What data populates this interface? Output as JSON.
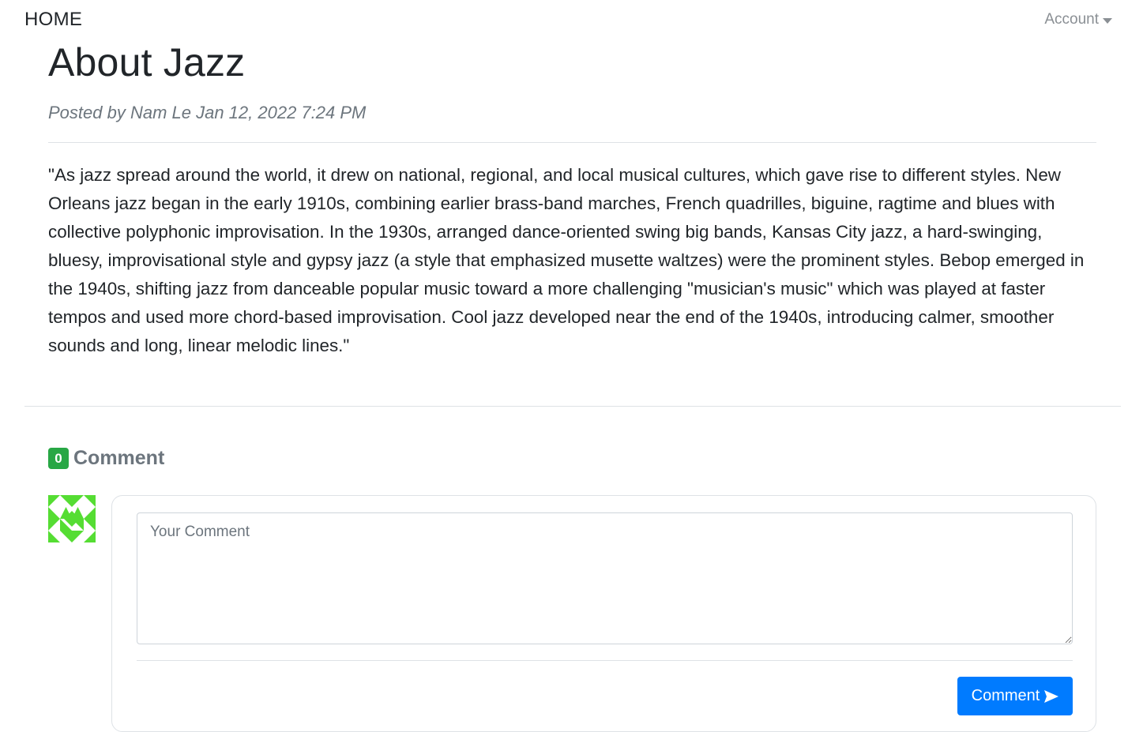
{
  "nav": {
    "home_label": "HOME",
    "account_label": "Account"
  },
  "post": {
    "title": "About Jazz",
    "meta": "Posted by Nam Le Jan 12, 2022 7:24 PM",
    "body": "\"As jazz spread around the world, it drew on national, regional, and local musical cultures, which gave rise to different styles. New Orleans jazz began in the early 1910s, combining earlier brass-band marches, French quadrilles, biguine, ragtime and blues with collective polyphonic improvisation. In the 1930s, arranged dance-oriented swing big bands, Kansas City jazz, a hard-swinging, bluesy, improvisational style and gypsy jazz (a style that emphasized musette waltzes) were the prominent styles. Bebop emerged in the 1940s, shifting jazz from danceable popular music toward a more challenging \"musician's music\" which was played at faster tempos and used more chord-based improvisation. Cool jazz developed near the end of the 1940s, introducing calmer, smoother sounds and long, linear melodic lines.\""
  },
  "comments": {
    "count": "0",
    "label": "Comment",
    "textarea_value": "",
    "textarea_placeholder": "Your Comment",
    "submit_label": "Comment",
    "submit_icon": "send-icon"
  },
  "colors": {
    "badge": "#28a745",
    "primary_button": "#007bff",
    "avatar_green": "#55dd33"
  }
}
